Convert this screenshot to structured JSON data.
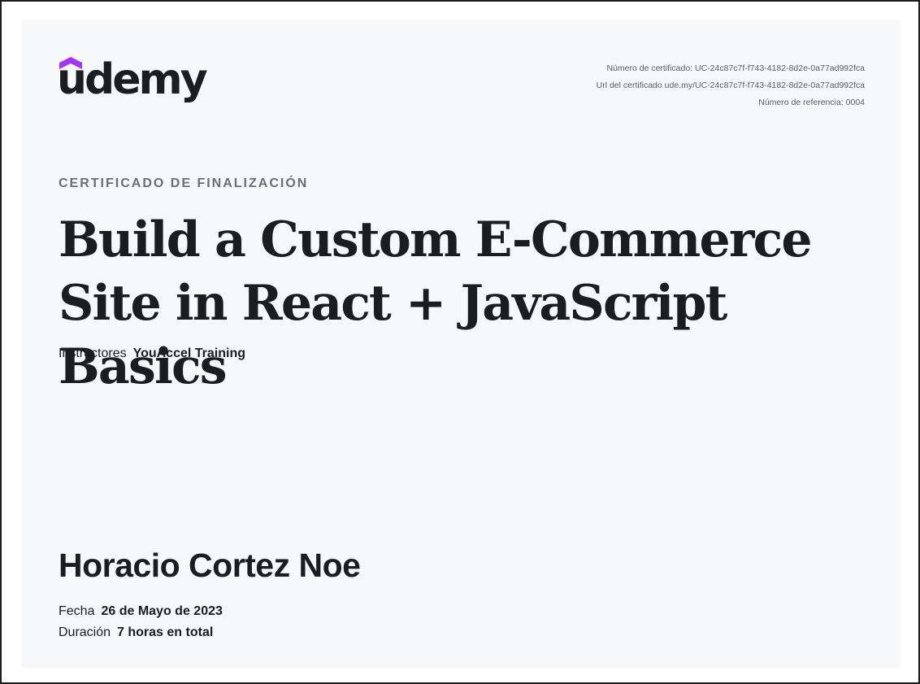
{
  "brand": {
    "logo_text": "udemy",
    "logo_color": "#1c1d1f",
    "accent_color": "#a435f0"
  },
  "certificate_meta": {
    "number_line": "Número de certificado: UC-24c87c7f-f743-4182-8d2e-0a77ad992fca",
    "url_line": "Url del certificado ude.my/UC-24c87c7f-f743-4182-8d2e-0a77ad992fca",
    "reference_line": "Número de referencia: 0004"
  },
  "kicker": "CERTIFICADO DE FINALIZACIÓN",
  "course_title": "Build a Custom E-Commerce Site in React + JavaScript Basics",
  "instructors": {
    "label": "Instructores",
    "value": "YouAccel Training"
  },
  "student_name": "Horacio Cortez Noe",
  "date": {
    "label": "Fecha",
    "value": "26 de Mayo de 2023"
  },
  "duration": {
    "label": "Duración",
    "value": "7 horas en total"
  },
  "colors": {
    "page_background": "#f7f8fa",
    "frame_border": "#1c1d1f",
    "text_primary": "#1c1d1f",
    "text_muted": "#6a6f73"
  }
}
